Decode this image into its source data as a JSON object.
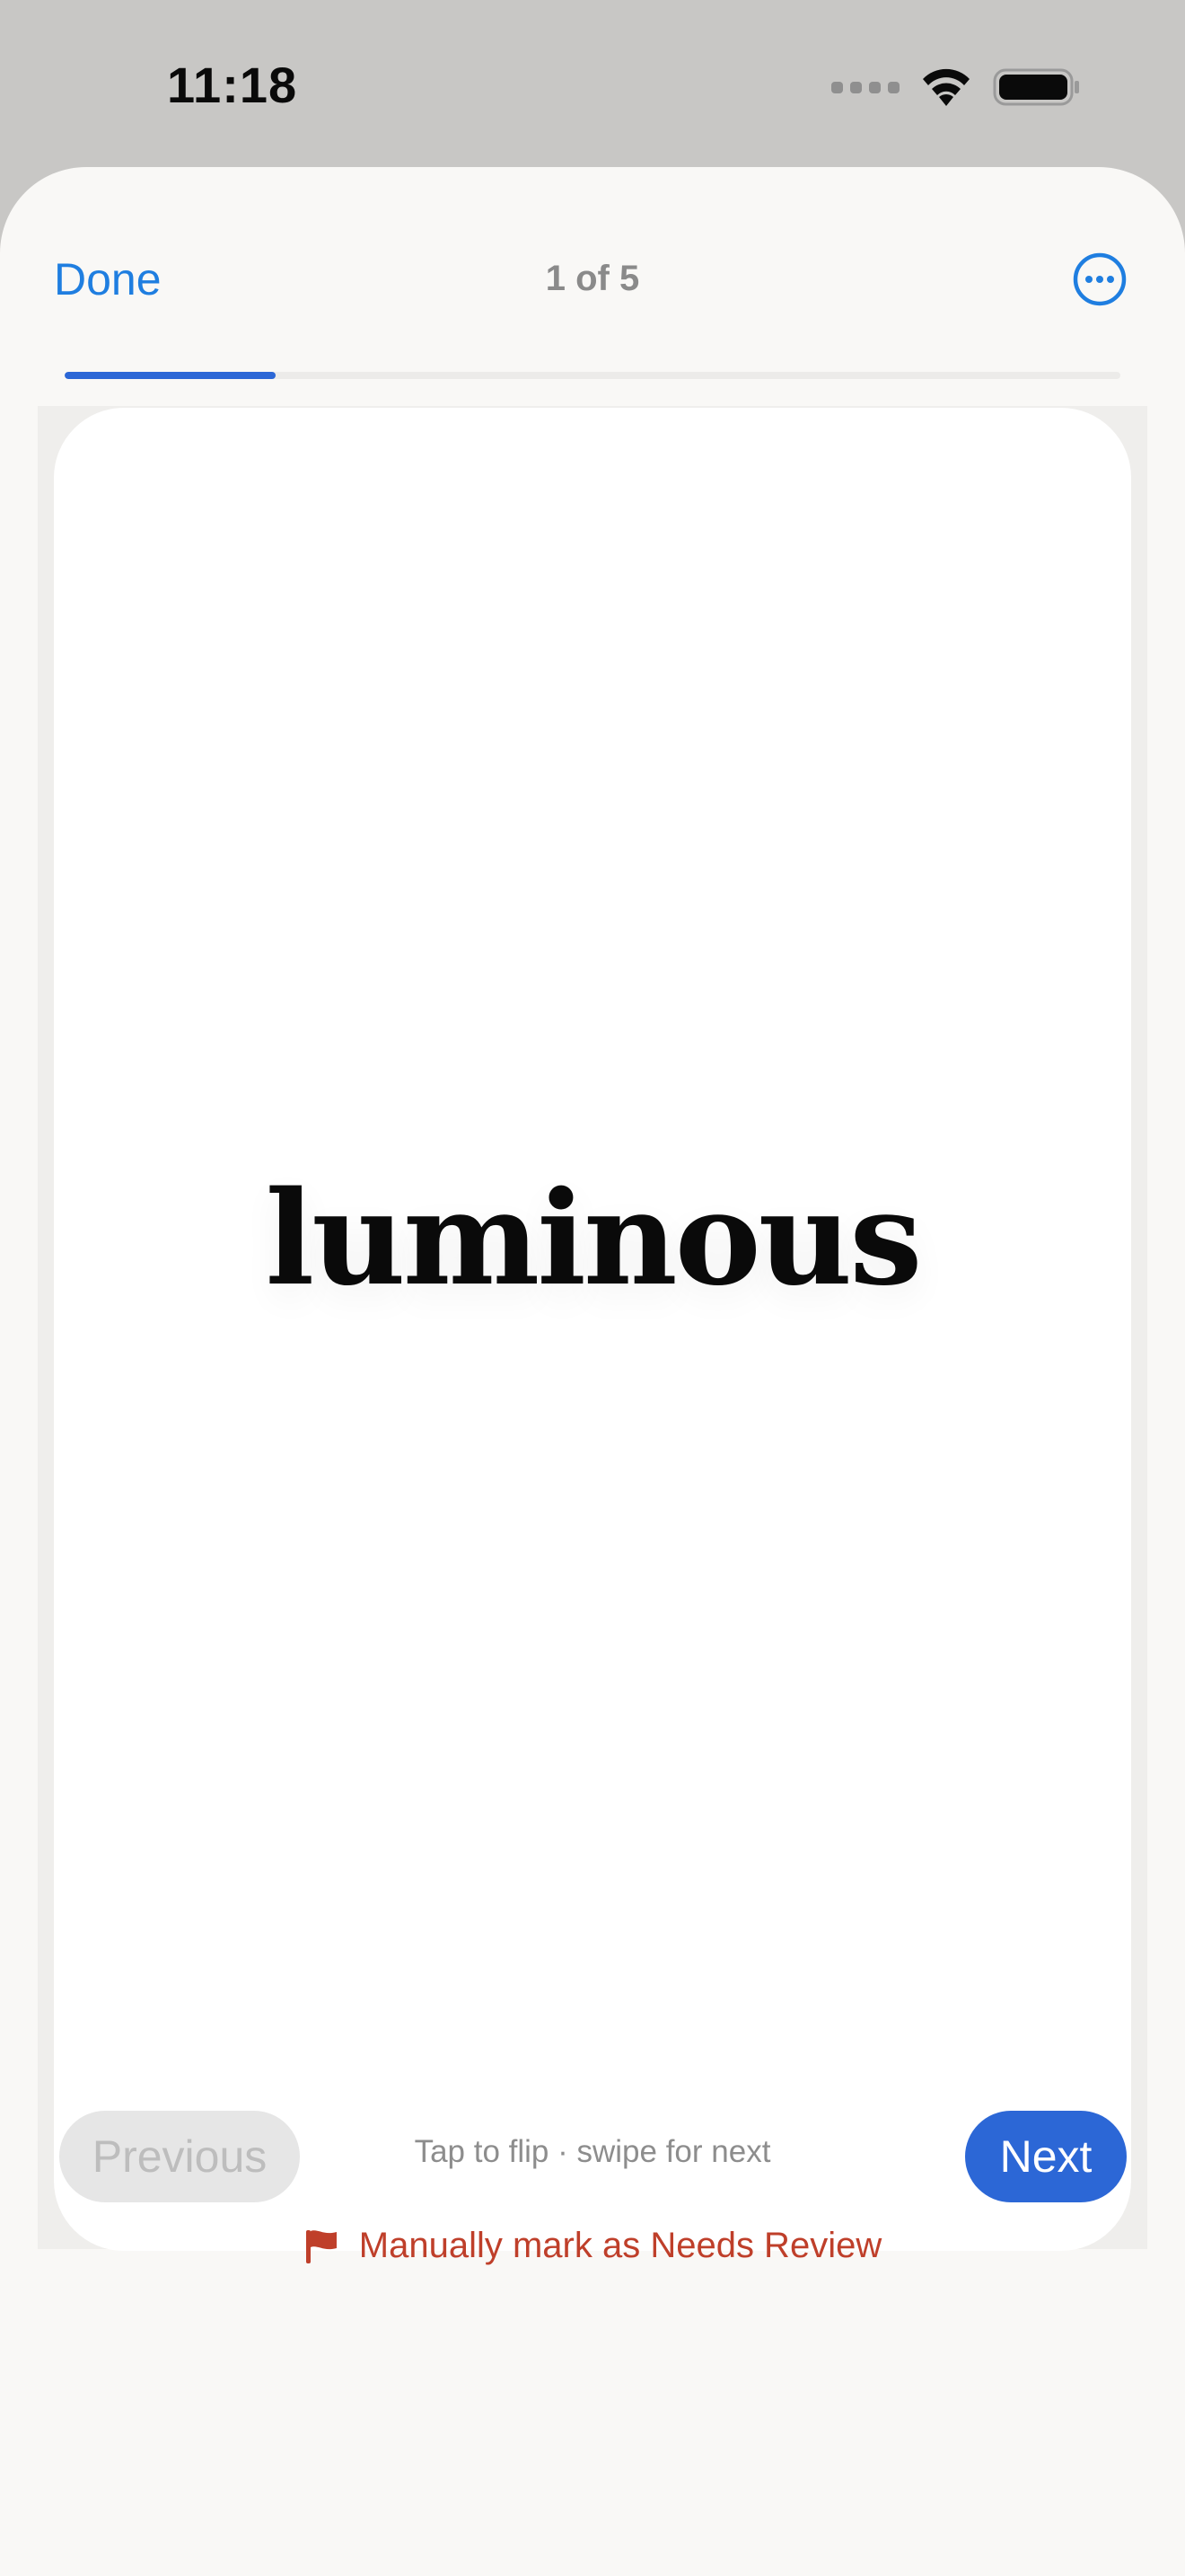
{
  "status_bar": {
    "time": "11:18"
  },
  "nav": {
    "done_label": "Done",
    "counter": "1 of 5",
    "more_icon": "ellipsis-circle-icon"
  },
  "progress": {
    "current": 1,
    "total": 5,
    "fraction": 0.2
  },
  "card": {
    "word": "luminous",
    "hint": "Tap to flip · swipe for next"
  },
  "controls": {
    "previous_label": "Previous",
    "previous_enabled": false,
    "next_label": "Next",
    "review_label": "Manually mark as Needs Review",
    "review_icon": "flag-icon"
  },
  "colors": {
    "accent": "#2c67d6",
    "link": "#1f7ee0",
    "review": "#bf3f2a",
    "sheet": "#f9f8f6"
  }
}
